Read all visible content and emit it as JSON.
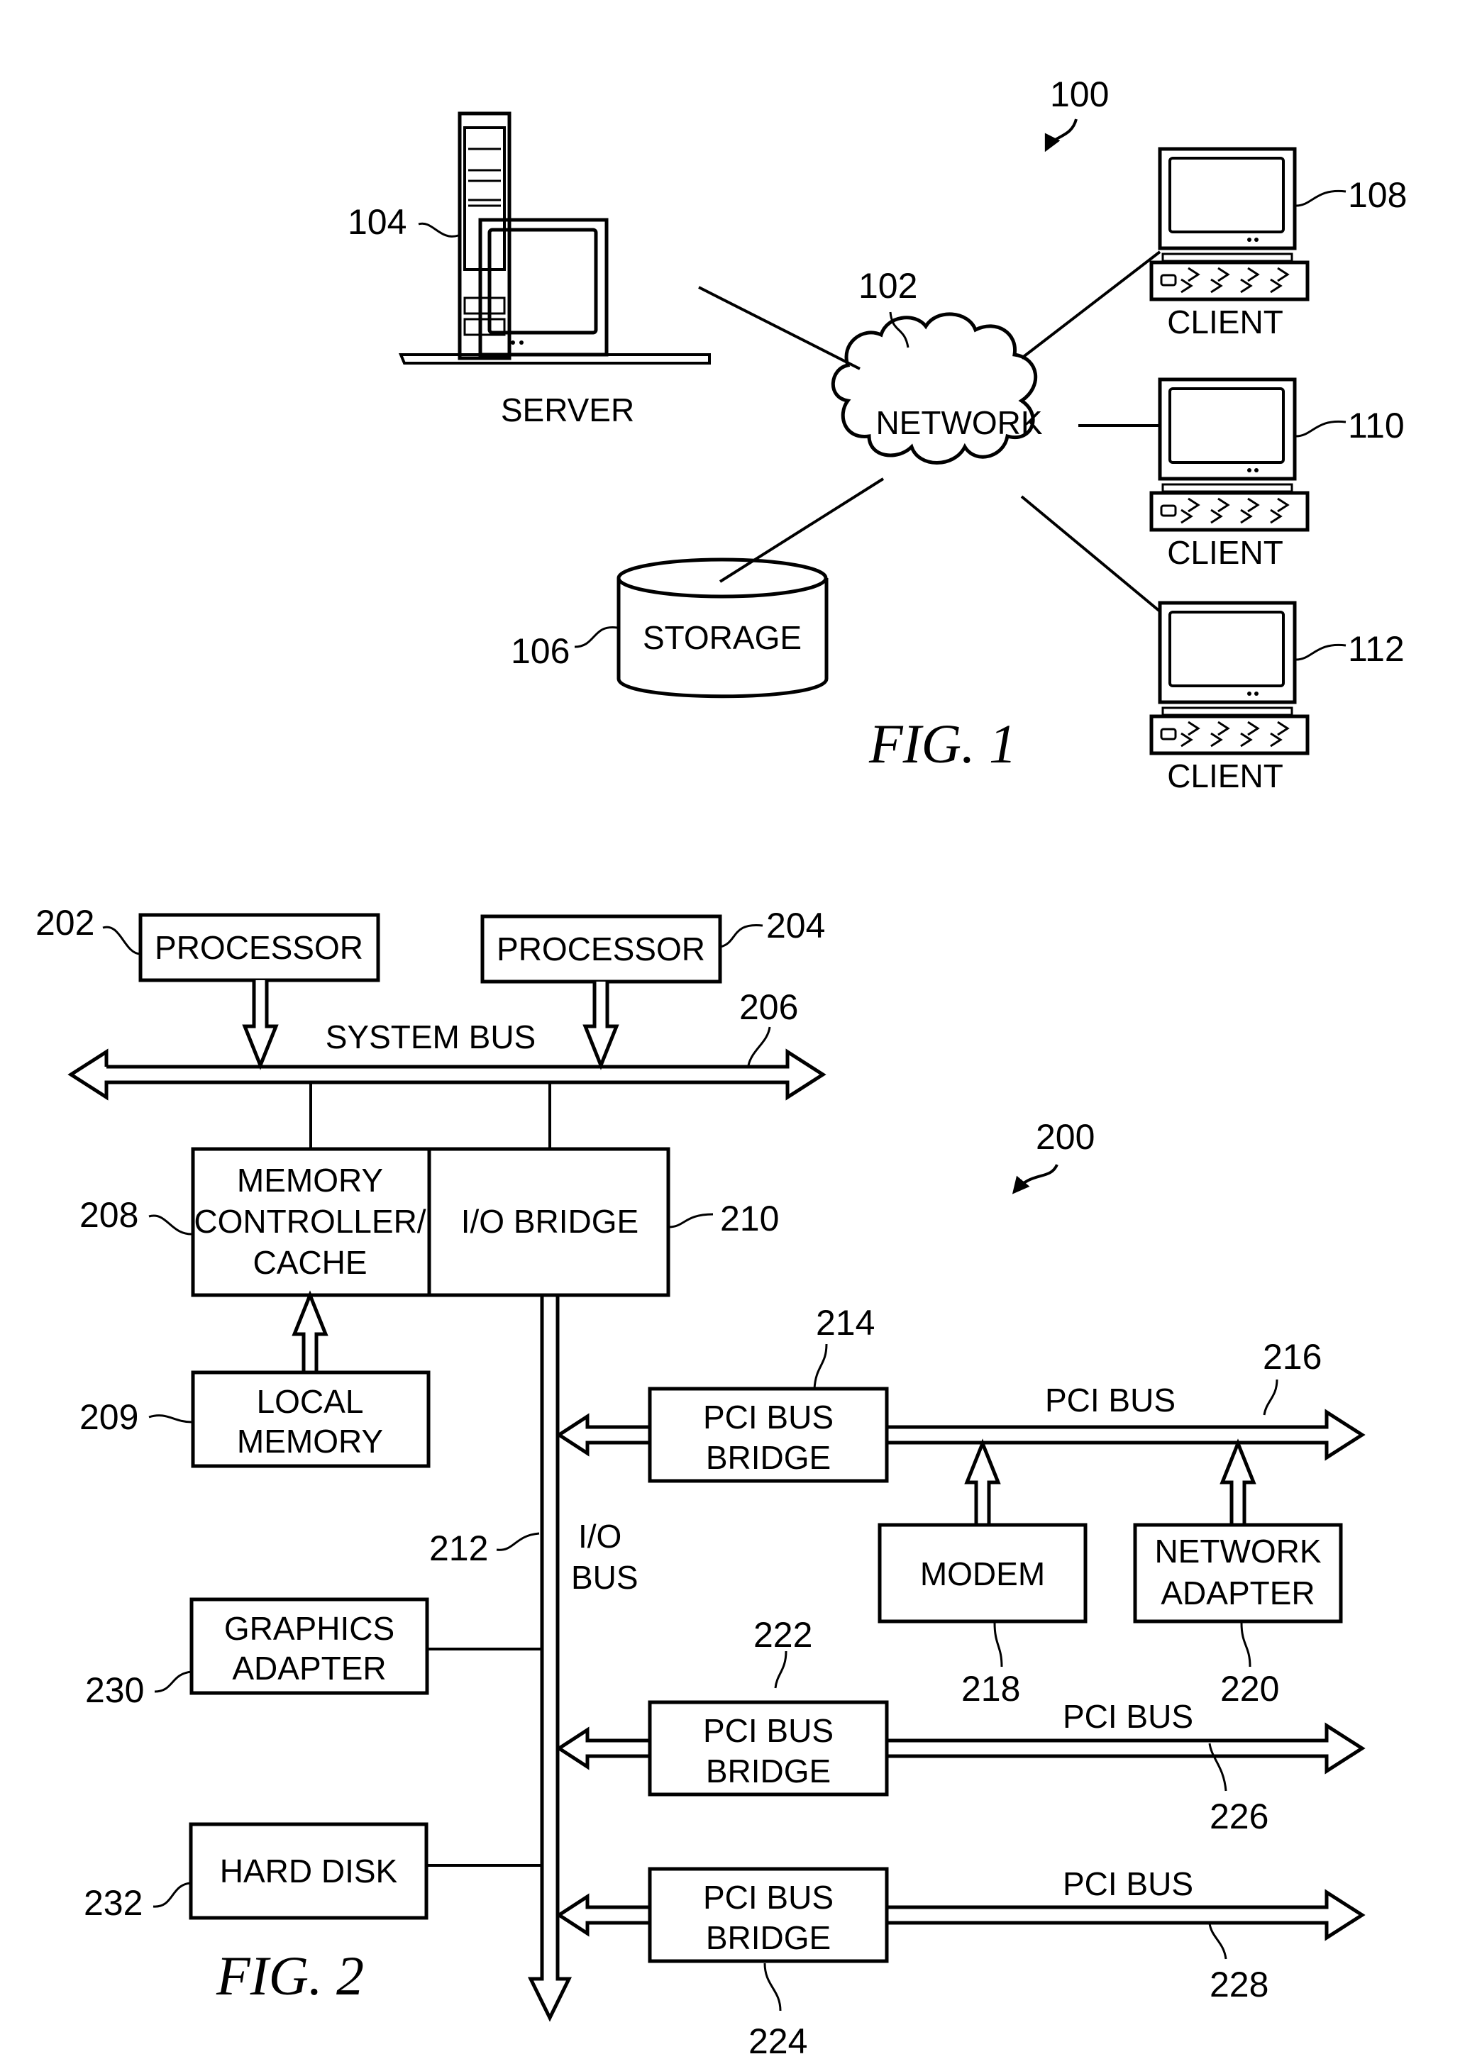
{
  "figures": [
    {
      "id": "fig1",
      "caption": "FIG. 1",
      "system_ref": "100",
      "nodes": {
        "network": {
          "ref": "102",
          "label": "NETWORK"
        },
        "server": {
          "ref": "104",
          "label": "SERVER"
        },
        "storage": {
          "ref": "106",
          "label": "STORAGE"
        },
        "client1": {
          "ref": "108",
          "label": "CLIENT"
        },
        "client2": {
          "ref": "110",
          "label": "CLIENT"
        },
        "client3": {
          "ref": "112",
          "label": "CLIENT"
        }
      },
      "connections": [
        [
          "server",
          "network"
        ],
        [
          "storage",
          "network"
        ],
        [
          "network",
          "client1"
        ],
        [
          "network",
          "client2"
        ],
        [
          "network",
          "client3"
        ]
      ]
    },
    {
      "id": "fig2",
      "caption": "FIG. 2",
      "system_ref": "200",
      "nodes": {
        "processor1": {
          "ref": "202",
          "label": "PROCESSOR"
        },
        "processor2": {
          "ref": "204",
          "label": "PROCESSOR"
        },
        "system_bus": {
          "ref": "206",
          "label": "SYSTEM BUS"
        },
        "memory_controller": {
          "ref": "208",
          "label_lines": [
            "MEMORY",
            "CONTROLLER/",
            "CACHE"
          ]
        },
        "local_memory": {
          "ref": "209",
          "label_lines": [
            "LOCAL",
            "MEMORY"
          ]
        },
        "io_bridge": {
          "ref": "210",
          "label": "I/O BRIDGE"
        },
        "io_bus": {
          "ref": "212",
          "label_lines": [
            "I/O",
            "BUS"
          ]
        },
        "pci_bridge1": {
          "ref": "214",
          "label_lines": [
            "PCI BUS",
            "BRIDGE"
          ]
        },
        "pci_bus1": {
          "ref": "216",
          "label": "PCI BUS"
        },
        "modem": {
          "ref": "218",
          "label": "MODEM"
        },
        "network_adapter": {
          "ref": "220",
          "label_lines": [
            "NETWORK",
            "ADAPTER"
          ]
        },
        "pci_bridge2": {
          "ref": "222",
          "label_lines": [
            "PCI BUS",
            "BRIDGE"
          ]
        },
        "pci_bridge3": {
          "ref": "224",
          "label_lines": [
            "PCI BUS",
            "BRIDGE"
          ]
        },
        "pci_bus2": {
          "ref": "226",
          "label": "PCI BUS"
        },
        "pci_bus3": {
          "ref": "228",
          "label": "PCI BUS"
        },
        "graphics_adapter": {
          "ref": "230",
          "label_lines": [
            "GRAPHICS",
            "ADAPTER"
          ]
        },
        "hard_disk": {
          "ref": "232",
          "label": "HARD DISK"
        }
      }
    }
  ]
}
